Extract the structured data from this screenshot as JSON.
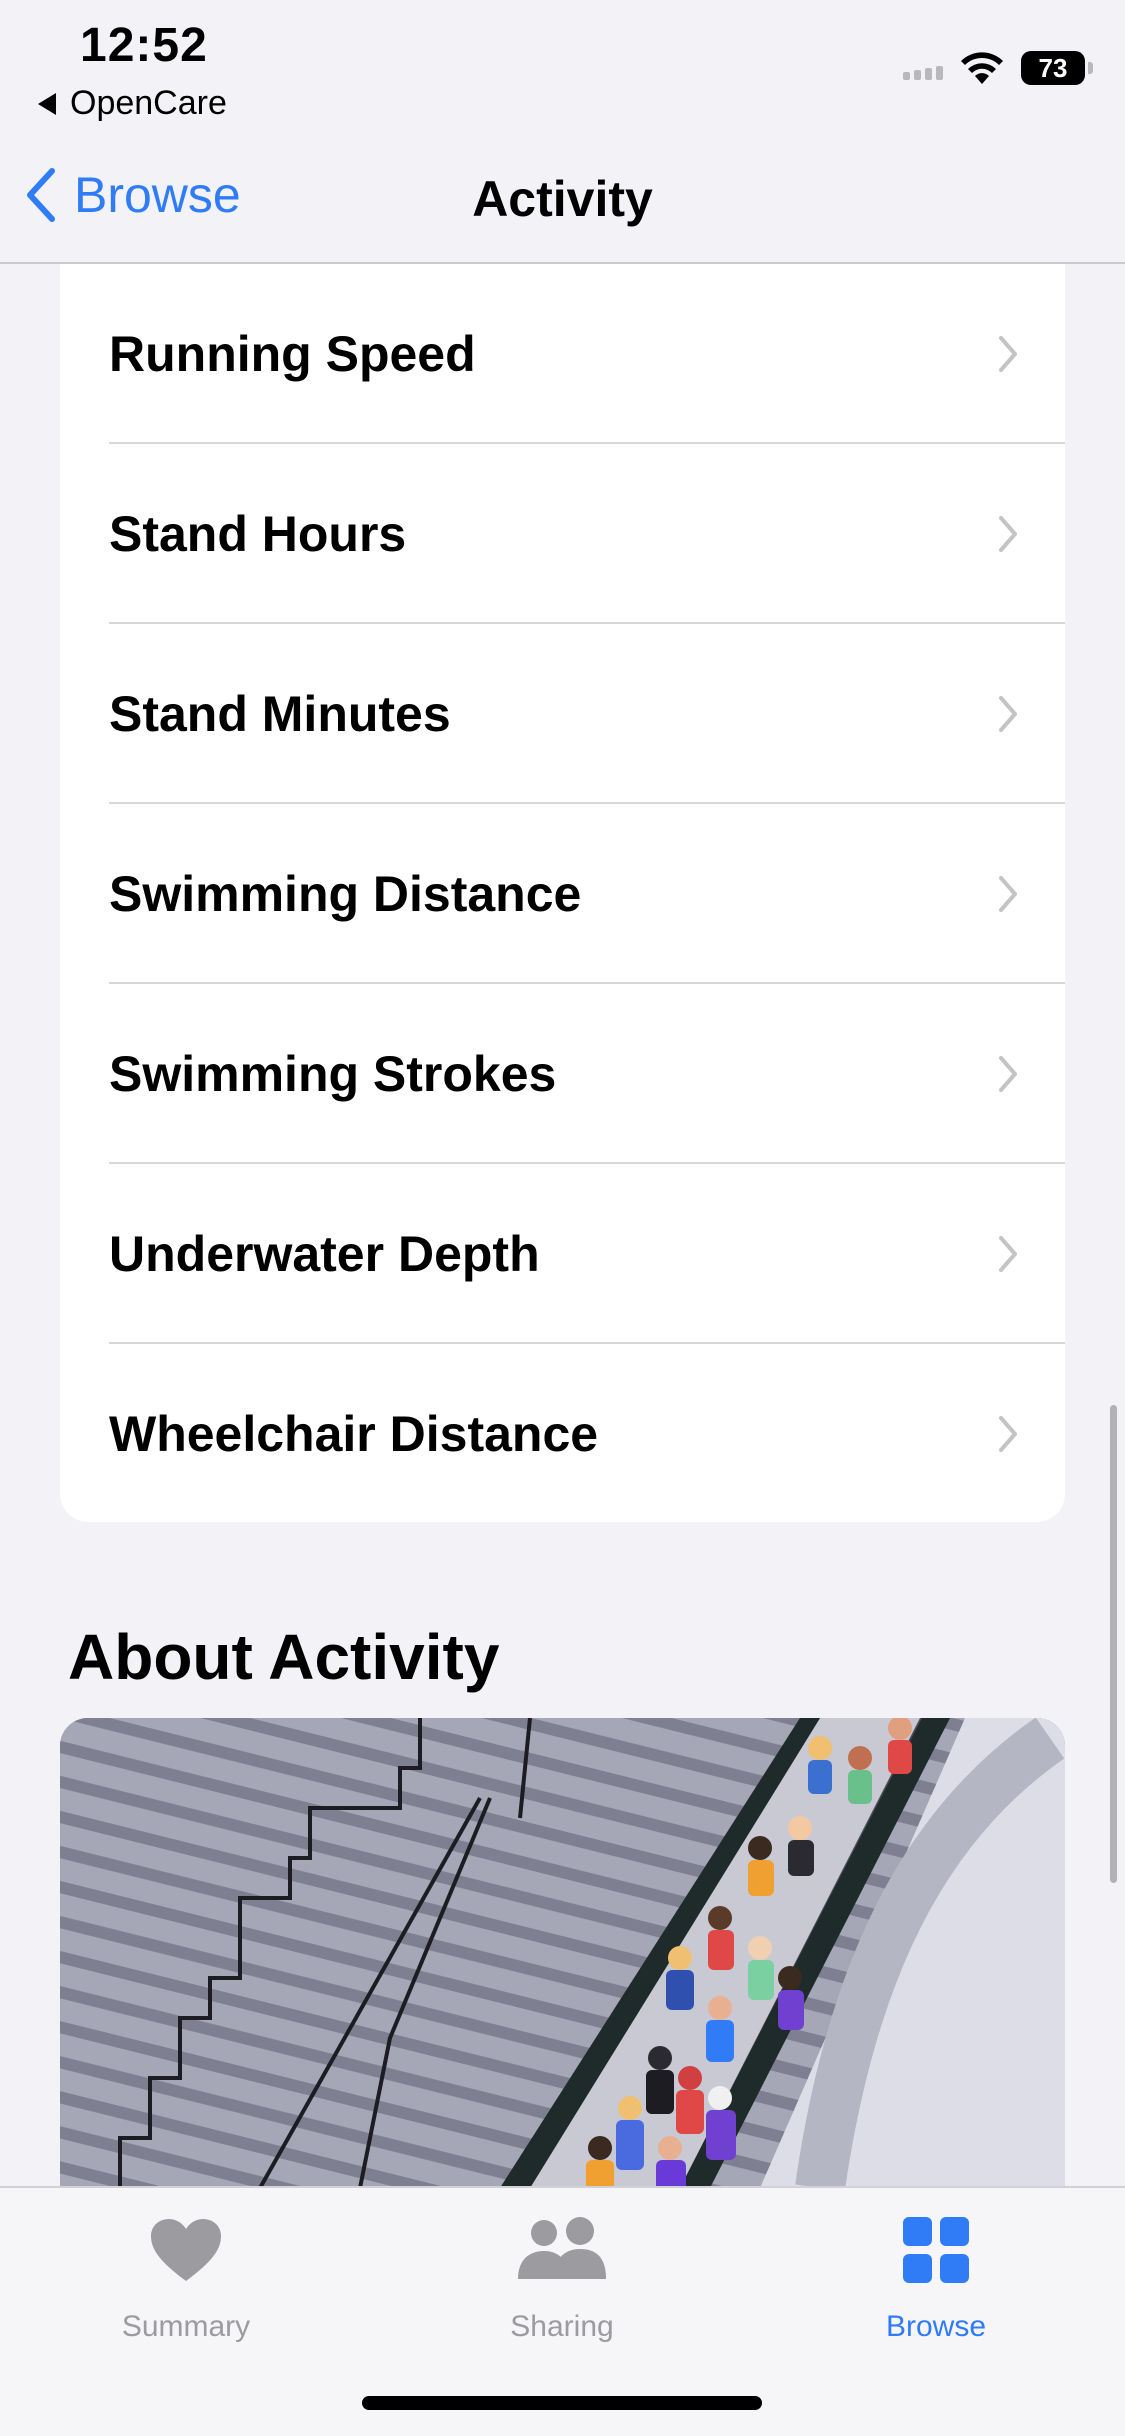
{
  "status_bar": {
    "time": "12:52",
    "back_app": "OpenCare",
    "battery": "73"
  },
  "nav": {
    "back_label": "Browse",
    "title": "Activity"
  },
  "list": {
    "items": [
      {
        "label": "Running Speed"
      },
      {
        "label": "Stand Hours"
      },
      {
        "label": "Stand Minutes"
      },
      {
        "label": "Swimming Distance"
      },
      {
        "label": "Swimming Strokes"
      },
      {
        "label": "Underwater Depth"
      },
      {
        "label": "Wheelchair Distance"
      }
    ]
  },
  "about": {
    "title": "About Activity"
  },
  "tabbar": {
    "tabs": [
      {
        "label": "Summary",
        "icon": "heart-icon",
        "active": false
      },
      {
        "label": "Sharing",
        "icon": "people-icon",
        "active": false
      },
      {
        "label": "Browse",
        "icon": "grid-icon",
        "active": true
      }
    ]
  },
  "colors": {
    "accent": "#2f7cf6",
    "background": "#f2f2f7",
    "inactive": "#9b9ba0"
  }
}
